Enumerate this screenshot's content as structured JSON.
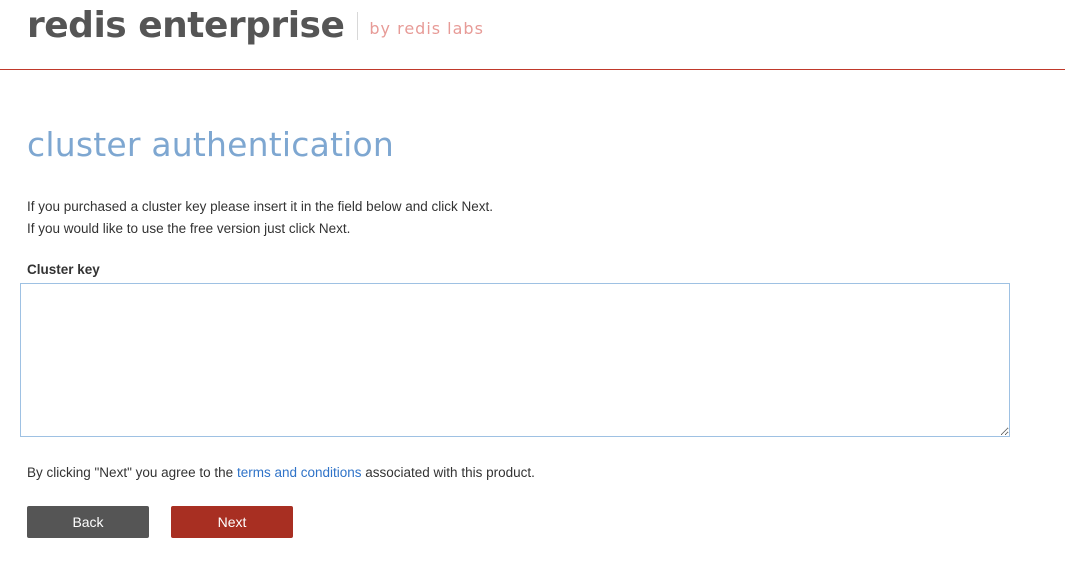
{
  "header": {
    "logo_text": "redis enterprise",
    "logo_subtext": "by redis labs",
    "accent_color": "#c0392b"
  },
  "main": {
    "title": "cluster authentication",
    "intro_line_1": "If you purchased a cluster key please insert it in the field below and click Next.",
    "intro_line_2": "If you would like to use the free version just click Next.",
    "cluster_key": {
      "label": "Cluster key",
      "value": "",
      "placeholder": ""
    },
    "agreement": {
      "prefix": "By clicking \"Next\" you agree to the ",
      "link_text": "terms and conditions",
      "suffix": " associated with this product."
    },
    "buttons": {
      "back_label": "Back",
      "next_label": "Next"
    }
  }
}
